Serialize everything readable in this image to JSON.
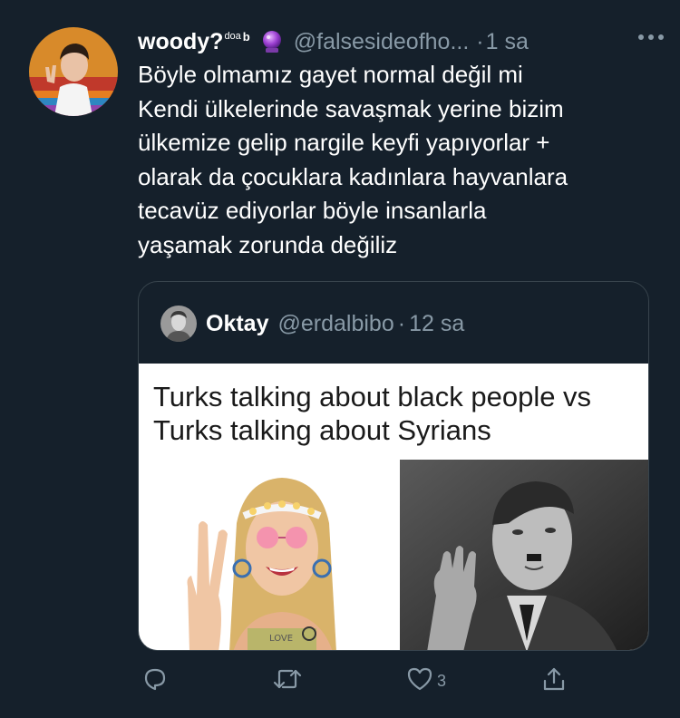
{
  "tweet": {
    "display_name": "woody?",
    "name_superscript": "doa",
    "name_superscript_b": "b",
    "name_emoji_icon": "crystal-ball-icon",
    "handle": "@falsesideofho...",
    "separator": "·",
    "time": "1 sa",
    "text_lines": [
      "Böyle olmamız gayet normal değil mi",
      "Kendi ülkelerinde savaşmak yerine bizim",
      "ülkemize gelip nargile keyfi yapıyorlar +",
      "olarak da çocuklara kadınlara hayvanlara",
      "tecavüz ediyorlar böyle insanlarla",
      "yaşamak zorunda değiliz"
    ]
  },
  "quoted": {
    "display_name": "Oktay",
    "handle": "@erdalbibo",
    "separator": "·",
    "time": "12 sa",
    "meme_title_lines": [
      "Turks talking about black people vs",
      "Turks talking about Syrians"
    ]
  },
  "actions": {
    "reply_icon": "reply-icon",
    "retweet_icon": "retweet-icon",
    "like_icon": "heart-icon",
    "like_count": "3",
    "share_icon": "share-icon"
  },
  "colors": {
    "background": "#15202b",
    "secondary_text": "#8899a6",
    "border": "#38444d"
  }
}
